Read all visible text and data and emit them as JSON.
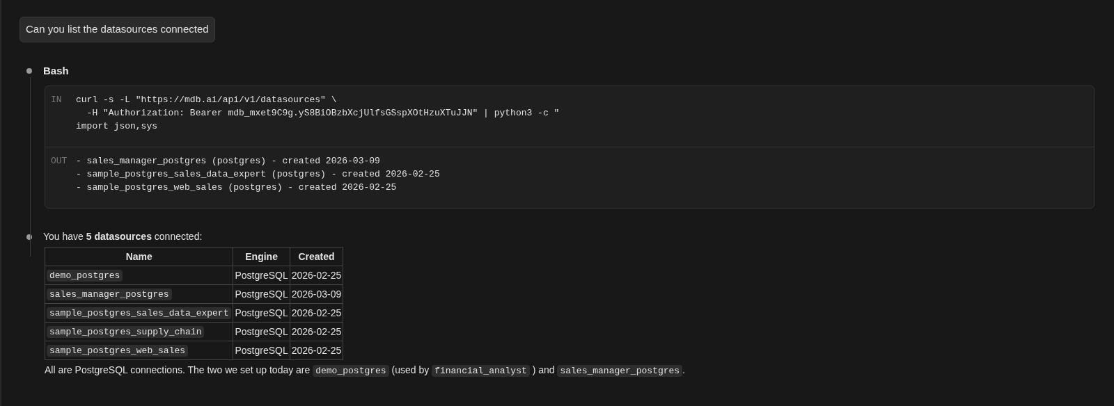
{
  "user_message": "Can you list the datasources connected",
  "tool_call": {
    "title": "Bash",
    "input_label": "IN",
    "input_lines": [
      "curl -s -L \"https://mdb.ai/api/v1/datasources\" \\",
      "  -H \"Authorization: Bearer mdb_mxet9C9g.yS8BiOBzbXcjUlfsGSspXOtHzuXTuJJN\" | python3 -c \"",
      "import json,sys"
    ],
    "output_label": "OUT",
    "output_lines": [
      "- sales_manager_postgres (postgres) - created 2026-03-09",
      "- sample_postgres_sales_data_expert (postgres) - created 2026-02-25",
      "- sample_postgres_web_sales (postgres) - created 2026-02-25"
    ]
  },
  "reply": {
    "intro": "You have **5 datasources** connected:",
    "table": {
      "columns": [
        "Name",
        "Engine",
        "Created"
      ],
      "rows": [
        [
          "demo_postgres",
          "PostgreSQL",
          "2026-02-25"
        ],
        [
          "sales_manager_postgres",
          "PostgreSQL",
          "2026-03-09"
        ],
        [
          "sample_postgres_sales_data_expert",
          "PostgreSQL",
          "2026-02-25"
        ],
        [
          "sample_postgres_supply_chain",
          "PostgreSQL",
          "2026-02-25"
        ],
        [
          "sample_postgres_web_sales",
          "PostgreSQL",
          "2026-02-25"
        ]
      ]
    },
    "summary": [
      {
        "kind": "text",
        "text": "All are PostgreSQL connections. The two we set up today are"
      },
      {
        "kind": "code",
        "text": "demo_postgres"
      },
      {
        "kind": "text",
        "text": "(used by"
      },
      {
        "kind": "code",
        "text": "financial_analyst"
      },
      {
        "kind": "text",
        "text": ") and"
      },
      {
        "kind": "code",
        "text": "sales_manager_postgres"
      },
      {
        "kind": "text",
        "text": "."
      }
    ]
  }
}
